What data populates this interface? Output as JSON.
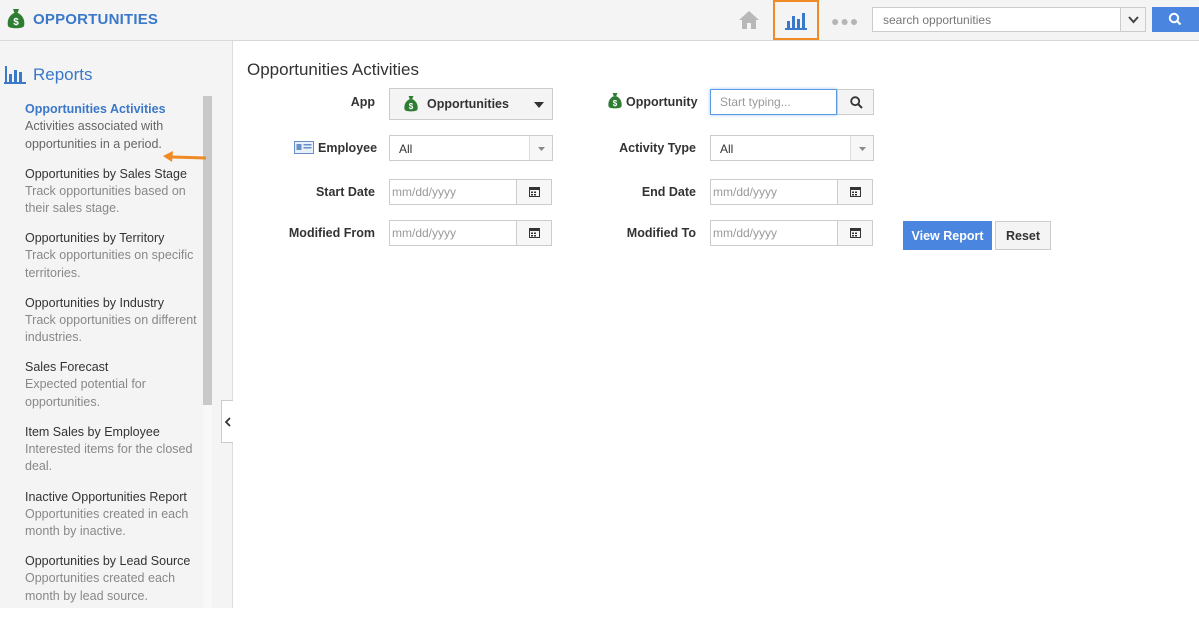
{
  "header": {
    "app_title": "OPPORTUNITIES",
    "search_placeholder": "search opportunities",
    "accent_color": "#3a78c9",
    "highlight_color": "#f08a24",
    "icons": [
      "money-bag-icon",
      "home-icon",
      "bar-chart-icon",
      "more-icon",
      "chevron-down-icon",
      "search-icon"
    ]
  },
  "sidebar": {
    "heading": "Reports",
    "items": [
      {
        "title": "Opportunities Activities",
        "desc": "Activities associated with opportunities in a period.",
        "active": true
      },
      {
        "title": "Opportunities by Sales Stage",
        "desc": "Track opportunities based on their sales stage."
      },
      {
        "title": "Opportunities by Territory",
        "desc": "Track opportunities on specific territories."
      },
      {
        "title": "Opportunities by Industry",
        "desc": "Track opportunities on different industries."
      },
      {
        "title": "Sales Forecast",
        "desc": "Expected potential for opportunities."
      },
      {
        "title": "Item Sales by Employee",
        "desc": "Interested items for the closed deal."
      },
      {
        "title": "Inactive Opportunities Report",
        "desc": "Opportunities created in each month by inactive."
      },
      {
        "title": "Opportunities by Lead Source",
        "desc": "Opportunities created each month by lead source."
      }
    ]
  },
  "main": {
    "title": "Opportunities Activities",
    "form": {
      "app_label": "App",
      "app_value": "Opportunities",
      "opportunity_label": "Opportunity",
      "opportunity_placeholder": "Start typing...",
      "employee_label": "Employee",
      "employee_value": "All",
      "activity_type_label": "Activity Type",
      "activity_type_value": "All",
      "start_date_label": "Start Date",
      "end_date_label": "End Date",
      "modified_from_label": "Modified From",
      "modified_to_label": "Modified To",
      "date_placeholder": "mm/dd/yyyy"
    },
    "buttons": {
      "view_report": "View Report",
      "reset": "Reset"
    }
  }
}
